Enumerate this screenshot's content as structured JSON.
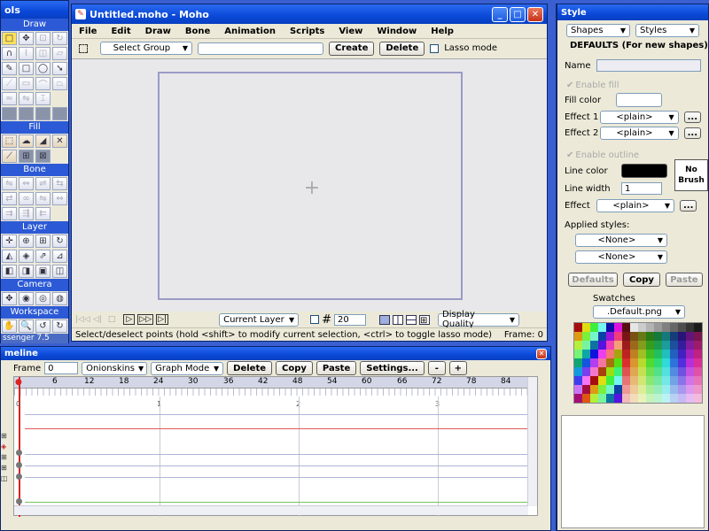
{
  "tools_panel": {
    "title": "ols",
    "sections": {
      "draw": "Draw",
      "fill": "Fill",
      "bone": "Bone",
      "layer": "Layer",
      "camera": "Camera",
      "workspace": "Workspace"
    },
    "footer": "ssenger 7.5"
  },
  "main_window": {
    "title": "Untitled.moho - Moho",
    "menu": [
      "File",
      "Edit",
      "Draw",
      "Bone",
      "Animation",
      "Scripts",
      "View",
      "Window",
      "Help"
    ],
    "toolbar": {
      "select_group": "Select Group",
      "create": "Create",
      "delete": "Delete",
      "lasso": "Lasso mode"
    },
    "bottombar": {
      "current_layer": "Current Layer",
      "grid_value": "20",
      "display_quality": "Display Quality"
    },
    "status": {
      "message": "Select/deselect points (hold <shift> to modify current selection, <ctrl> to toggle lasso mode)",
      "frame": "Frame: 0"
    }
  },
  "timeline": {
    "title": "meline",
    "frame_label": "Frame",
    "frame_value": "0",
    "onionskins": "Onionskins",
    "graph_mode": "Graph Mode",
    "delete": "Delete",
    "copy": "Copy",
    "paste": "Paste",
    "settings": "Settings...",
    "minus": "-",
    "plus": "+",
    "ruler": [
      "6",
      "12",
      "18",
      "24",
      "30",
      "36",
      "42",
      "48",
      "54",
      "60",
      "66",
      "72",
      "78",
      "84"
    ],
    "markers": [
      "0",
      "1",
      "2",
      "3"
    ]
  },
  "style_panel": {
    "title": "Style",
    "tabs": {
      "shapes": "Shapes",
      "styles": "Styles"
    },
    "defaults_heading": "DEFAULTS (For new shapes)",
    "name_label": "Name",
    "enable_fill": "Enable fill",
    "fill_color": "Fill color",
    "effect1_label": "Effect 1",
    "effect2_label": "Effect 2",
    "plain": "<plain>",
    "enable_outline": "Enable outline",
    "line_color": "Line color",
    "line_width_label": "Line width",
    "line_width_value": "1",
    "effect_label": "Effect",
    "no_brush": "No Brush",
    "applied_styles": "Applied styles:",
    "none": "<None>",
    "defaults_btn": "Defaults",
    "copy_btn": "Copy",
    "paste_btn": "Paste",
    "swatches_label": "Swatches",
    "swatches_file": ".Default.png",
    "ellipsis": "..."
  },
  "colors": {
    "titlebar": "#0a48d8",
    "accent": "#2c5ad6",
    "desktop": "#3a5fd0"
  }
}
